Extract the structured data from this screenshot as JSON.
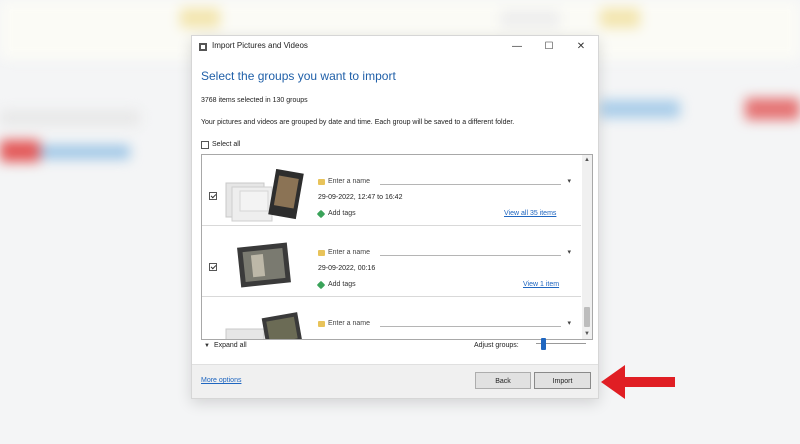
{
  "window": {
    "title": "Import Pictures and Videos",
    "minimize_glyph": "—",
    "maximize_glyph": "☐",
    "close_glyph": "✕"
  },
  "heading": "Select the groups you want to import",
  "summary": "3768 items selected in 130 groups",
  "description": "Your pictures and videos are grouped by date and time. Each group will be saved to a different folder.",
  "select_all": {
    "label": "Select all",
    "checked": false
  },
  "groups": [
    {
      "checked": true,
      "name_placeholder": "Enter a name",
      "date": "29-09-2022, 12:47 to 16:42",
      "tags_label": "Add tags",
      "view_link": "View all 35 items"
    },
    {
      "checked": true,
      "name_placeholder": "Enter a name",
      "date": "29-09-2022, 00:16",
      "tags_label": "Add tags",
      "view_link": "View 1 item"
    },
    {
      "checked": true,
      "name_placeholder": "Enter a name",
      "date": "",
      "tags_label": "",
      "view_link": ""
    }
  ],
  "expand_all": "Expand all",
  "adjust_groups": {
    "label": "Adjust groups:",
    "value": 0.1
  },
  "footer": {
    "more_options": "More options",
    "back": "Back",
    "import": "Import"
  },
  "annotation": {
    "arrow_color": "#e01e24"
  },
  "colors": {
    "heading": "#1f5fa8",
    "link": "#1f66c0",
    "accent": "#1f66c0"
  }
}
